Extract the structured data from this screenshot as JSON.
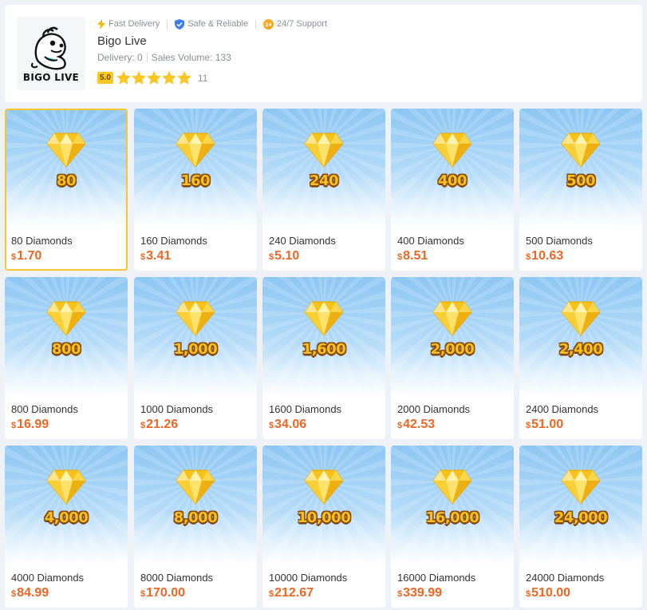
{
  "store": {
    "logo_text": "BIGO LIVE",
    "app_name": "Bigo Live",
    "features": [
      {
        "icon": "lightning-icon",
        "label": "Fast Delivery"
      },
      {
        "icon": "shield-icon",
        "label": "Safe & Reliable"
      },
      {
        "icon": "support-icon",
        "label": "24/7 Support"
      }
    ],
    "delivery": "Delivery: 0",
    "sales_volume": "Sales Volume: 133",
    "rating_score": "5.0",
    "stars": 5,
    "review_count": "11"
  },
  "colors": {
    "accent_price": "#f26522",
    "selected_border": "#f6c531",
    "rating_badge": "#f9c623",
    "star": "#f9c623"
  },
  "currency_symbol": "$",
  "products": [
    {
      "badge": "80",
      "title": "80 Diamonds",
      "price": "1.70",
      "selected": true
    },
    {
      "badge": "160",
      "title": "160 Diamonds",
      "price": "3.41"
    },
    {
      "badge": "240",
      "title": "240 Diamonds",
      "price": "5.10"
    },
    {
      "badge": "400",
      "title": "400 Diamonds",
      "price": "8.51"
    },
    {
      "badge": "500",
      "title": "500 Diamonds",
      "price": "10.63"
    },
    {
      "badge": "800",
      "title": "800 Diamonds",
      "price": "16.99"
    },
    {
      "badge": "1,000",
      "title": "1000 Diamonds",
      "price": "21.26"
    },
    {
      "badge": "1,600",
      "title": "1600 Diamonds",
      "price": "34.06"
    },
    {
      "badge": "2,000",
      "title": "2000 Diamonds",
      "price": "42.53"
    },
    {
      "badge": "2,400",
      "title": "2400 Diamonds",
      "price": "51.00"
    },
    {
      "badge": "4,000",
      "title": "4000 Diamonds",
      "price": "84.99"
    },
    {
      "badge": "8,000",
      "title": "8000 Diamonds",
      "price": "170.00"
    },
    {
      "badge": "10,000",
      "title": "10000 Diamonds",
      "price": "212.67"
    },
    {
      "badge": "16,000",
      "title": "16000 Diamonds",
      "price": "339.99"
    },
    {
      "badge": "24,000",
      "title": "24000 Diamonds",
      "price": "510.00"
    }
  ]
}
